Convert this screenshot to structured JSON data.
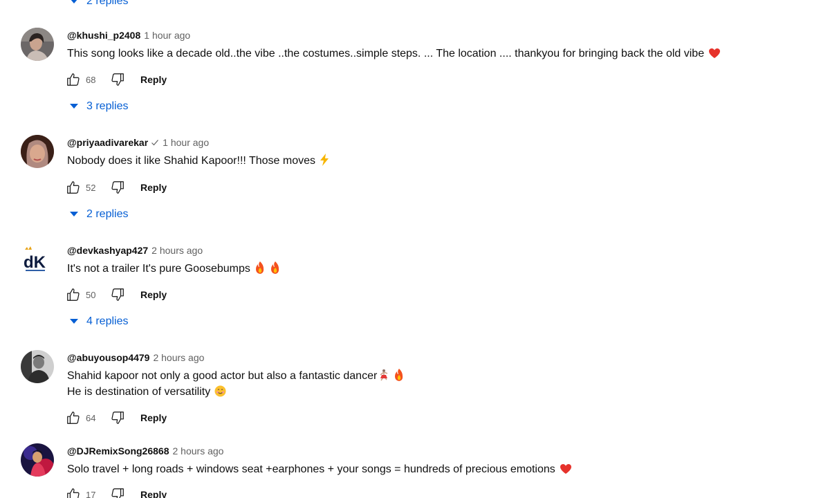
{
  "top_replies": {
    "label": "2 replies"
  },
  "comments": [
    {
      "author": "@khushi_p2408",
      "verified": false,
      "time": "1 hour ago",
      "lines": [
        "This song looks like a decade old..the vibe ..the costumes..simple steps. ... The location .... thankyou for bringing back the old vibe"
      ],
      "likes": "68",
      "reply_label": "Reply",
      "replies_label": "3 replies"
    },
    {
      "author": "@priyaadivarekar",
      "verified": true,
      "time": "1 hour ago",
      "lines": [
        "Nobody does it like Shahid Kapoor!!! Those moves"
      ],
      "likes": "52",
      "reply_label": "Reply",
      "replies_label": "2 replies"
    },
    {
      "author": "@devkashyap427",
      "verified": false,
      "time": "2 hours ago",
      "lines": [
        "It's not a trailer It's pure Goosebumps"
      ],
      "likes": "50",
      "reply_label": "Reply",
      "replies_label": "4 replies",
      "avatar_text": "dK"
    },
    {
      "author": "@abuyousop4479",
      "verified": false,
      "time": "2 hours ago",
      "lines": [
        "Shahid kapoor not only a good actor but also a fantastic dancer",
        "He is destination of versatility"
      ],
      "likes": "64",
      "reply_label": "Reply"
    },
    {
      "author": "@DJRemixSong26868",
      "verified": false,
      "time": "2 hours ago",
      "lines": [
        "Solo travel + long roads + windows seat +earphones + your songs = hundreds of precious emotions"
      ],
      "likes": "17",
      "reply_label": "Reply"
    }
  ],
  "icons": {
    "like": "thumbs-up-outline-icon",
    "dislike": "thumbs-down-outline-icon",
    "expand": "caret-down-icon",
    "verified": "checkmark-icon",
    "heart": "red-heart-emoji",
    "bolt": "high-voltage-emoji",
    "fire": "fire-emoji",
    "smile": "smiling-face-emoji",
    "dancer": "dancer-emoji"
  },
  "colors": {
    "link_blue": "#065fd4",
    "secondary_text": "#606060",
    "primary_text": "#0f0f0f"
  }
}
